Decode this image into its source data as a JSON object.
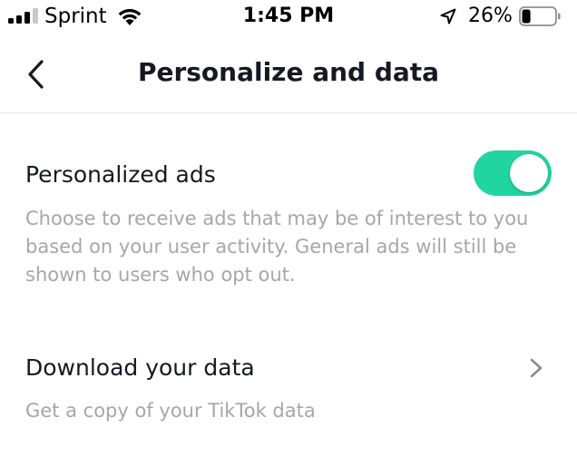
{
  "status_bar": {
    "carrier": "Sprint",
    "time": "1:45 PM",
    "battery_percent": "26%",
    "battery_level": 0.26,
    "signal_bars_active": 3,
    "signal_bars_total": 4,
    "icons": [
      "signal-bars-icon",
      "wifi-icon",
      "location-arrow-icon",
      "battery-icon"
    ]
  },
  "nav": {
    "title": "Personalize and data",
    "back_icon": "chevron-left-icon"
  },
  "settings": {
    "personalized_ads": {
      "title": "Personalized ads",
      "description": "Choose to receive ads that may be of interest to you based on your user activity. General ads will still be shown to users who opt out.",
      "enabled": true
    },
    "download_data": {
      "title": "Download your data",
      "description": "Get a copy of your TikTok data",
      "icon": "chevron-right-icon"
    }
  },
  "colors": {
    "toggle_on": "#20d5a0",
    "text_primary": "#161823",
    "text_secondary": "#a6a7ab",
    "divider": "#e3e3e4",
    "chevron": "#8a8b91"
  }
}
